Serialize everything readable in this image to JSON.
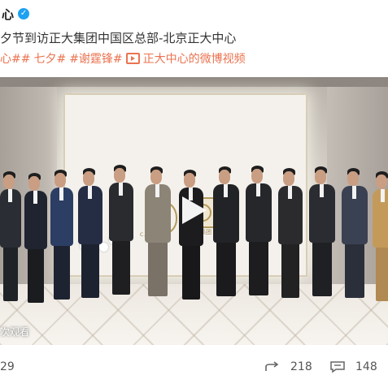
{
  "post": {
    "author": "心",
    "title": "夕节到访正大集团中国区总部-北京正大中心",
    "tags": [
      "心##",
      "七夕#",
      "#谢霆锋#"
    ],
    "video_link": "正大中心的微博视频"
  },
  "video": {
    "logo1_text": "C.P.Group",
    "logo2_text": "正大集团",
    "watch_text": "次观看"
  },
  "stats": {
    "like_count": "29",
    "forward_count": "218",
    "comment_count": "148"
  },
  "colors": {
    "tag": "#eb7350",
    "verified": "#1da1f2"
  },
  "icons": [
    "verified-icon",
    "video-link-icon",
    "play-icon",
    "forward-icon",
    "comment-icon"
  ]
}
